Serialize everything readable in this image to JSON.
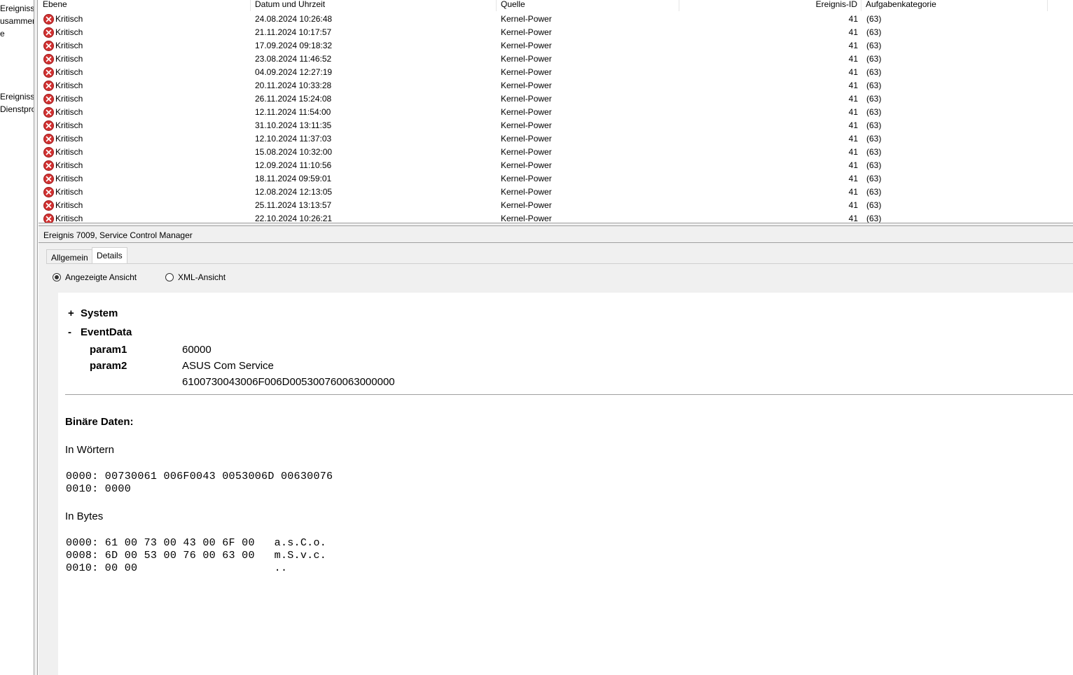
{
  "nav": {
    "items": [
      "Ereignisse",
      "usammen",
      "e",
      "Ereignisse",
      "Dienstpro"
    ]
  },
  "list": {
    "headers": {
      "level": "Ebene",
      "datetime": "Datum und Uhrzeit",
      "source": "Quelle",
      "event_id": "Ereignis-ID",
      "task_category": "Aufgabenkategorie"
    },
    "rows": [
      {
        "level": "Kritisch",
        "datetime": "24.08.2024 10:26:48",
        "source": "Kernel-Power",
        "event_id": "41",
        "task_category": "(63)"
      },
      {
        "level": "Kritisch",
        "datetime": "21.11.2024 10:17:57",
        "source": "Kernel-Power",
        "event_id": "41",
        "task_category": "(63)"
      },
      {
        "level": "Kritisch",
        "datetime": "17.09.2024 09:18:32",
        "source": "Kernel-Power",
        "event_id": "41",
        "task_category": "(63)"
      },
      {
        "level": "Kritisch",
        "datetime": "23.08.2024 11:46:52",
        "source": "Kernel-Power",
        "event_id": "41",
        "task_category": "(63)"
      },
      {
        "level": "Kritisch",
        "datetime": "04.09.2024 12:27:19",
        "source": "Kernel-Power",
        "event_id": "41",
        "task_category": "(63)"
      },
      {
        "level": "Kritisch",
        "datetime": "20.11.2024 10:33:28",
        "source": "Kernel-Power",
        "event_id": "41",
        "task_category": "(63)"
      },
      {
        "level": "Kritisch",
        "datetime": "26.11.2024 15:24:08",
        "source": "Kernel-Power",
        "event_id": "41",
        "task_category": "(63)"
      },
      {
        "level": "Kritisch",
        "datetime": "12.11.2024 11:54:00",
        "source": "Kernel-Power",
        "event_id": "41",
        "task_category": "(63)"
      },
      {
        "level": "Kritisch",
        "datetime": "31.10.2024 13:11:35",
        "source": "Kernel-Power",
        "event_id": "41",
        "task_category": "(63)"
      },
      {
        "level": "Kritisch",
        "datetime": "12.10.2024 11:37:03",
        "source": "Kernel-Power",
        "event_id": "41",
        "task_category": "(63)"
      },
      {
        "level": "Kritisch",
        "datetime": "15.08.2024 10:32:00",
        "source": "Kernel-Power",
        "event_id": "41",
        "task_category": "(63)"
      },
      {
        "level": "Kritisch",
        "datetime": "12.09.2024 11:10:56",
        "source": "Kernel-Power",
        "event_id": "41",
        "task_category": "(63)"
      },
      {
        "level": "Kritisch",
        "datetime": "18.11.2024 09:59:01",
        "source": "Kernel-Power",
        "event_id": "41",
        "task_category": "(63)"
      },
      {
        "level": "Kritisch",
        "datetime": "12.08.2024 12:13:05",
        "source": "Kernel-Power",
        "event_id": "41",
        "task_category": "(63)"
      },
      {
        "level": "Kritisch",
        "datetime": "25.11.2024 13:13:57",
        "source": "Kernel-Power",
        "event_id": "41",
        "task_category": "(63)"
      },
      {
        "level": "Kritisch",
        "datetime": "22.10.2024 10:26:21",
        "source": "Kernel-Power",
        "event_id": "41",
        "task_category": "(63)"
      }
    ]
  },
  "detail": {
    "title": "Ereignis 7009, Service Control Manager",
    "tabs": {
      "general": "Allgemein",
      "details": "Details"
    },
    "view_options": {
      "friendly": "Angezeigte Ansicht",
      "xml": "XML-Ansicht",
      "selected": "friendly"
    },
    "system_toggle": "+",
    "system_label": "System",
    "eventdata_toggle": "-",
    "eventdata_label": "EventData",
    "params": {
      "param1_name": "param1",
      "param1_value": "60000",
      "param2_name": "param2",
      "param2_value": "ASUS Com Service",
      "binary_inline": "6100730043006F006D005300760063000000"
    },
    "binary_title": "Binäre Daten:",
    "words_label": "In Wörtern",
    "words_lines": [
      "0000: 00730061 006F0043 0053006D 00630076",
      "0010: 0000"
    ],
    "bytes_label": "In Bytes",
    "bytes_lines": [
      "0000: 61 00 73 00 43 00 6F 00   a.s.C.o.",
      "0008: 6D 00 53 00 76 00 63 00   m.S.v.c.",
      "0010: 00 00                     .."
    ]
  }
}
